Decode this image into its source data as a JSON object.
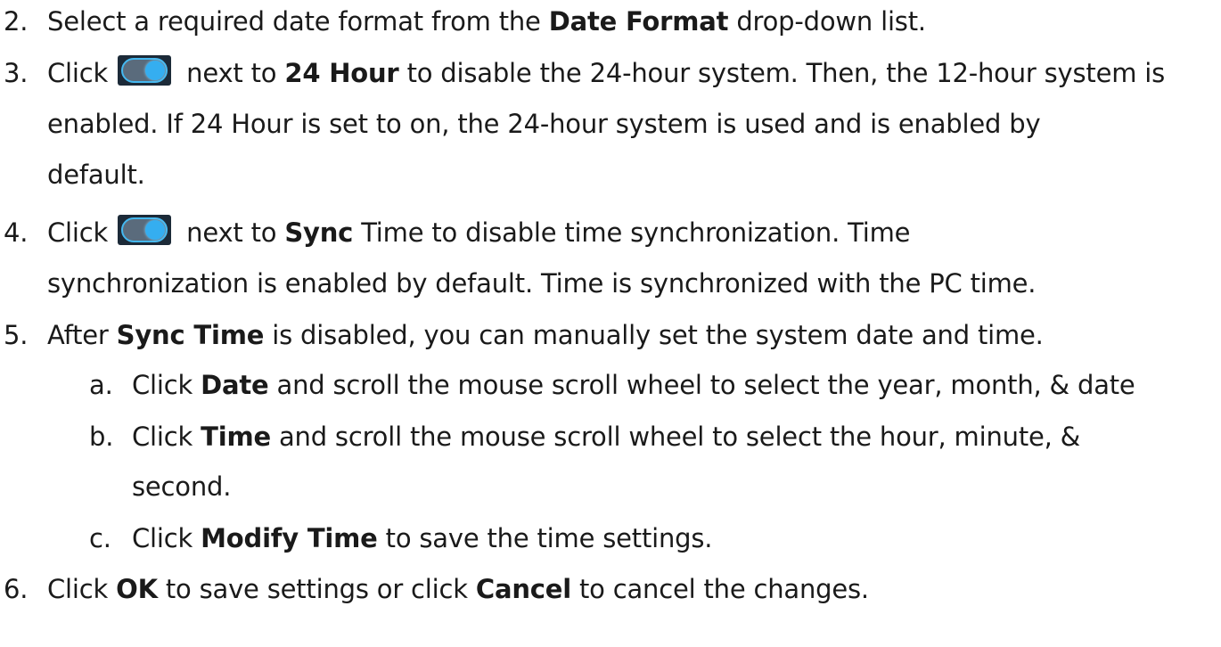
{
  "steps": [
    {
      "num": "2.",
      "parts": [
        "Select a required date format from the ",
        "Date Format",
        " drop-down list."
      ]
    },
    {
      "num": "3.",
      "parts": [
        "Click ",
        " next to ",
        "24 Hour",
        " to disable the 24-hour system. Then, the 12-hour system is"
      ],
      "cont1": "enabled. If 24 Hour is set to on, the 24-hour system is used and is enabled by",
      "cont2": "default."
    },
    {
      "num": "4.",
      "parts": [
        "Click ",
        " next to ",
        "Sync",
        " Time to disable time synchronization. Time"
      ],
      "cont1": "synchronization is enabled by default. Time is synchronized with the PC time."
    },
    {
      "num": "5.",
      "parts": [
        "After ",
        "Sync Time",
        " is disabled, you can manually set the system date and time."
      ],
      "substeps": [
        {
          "num": "a.",
          "parts": [
            "Click ",
            "Date",
            " and scroll the mouse scroll wheel to select the year, month, & date"
          ]
        },
        {
          "num": "b.",
          "parts": [
            "Click ",
            "Time",
            " and scroll the mouse scroll wheel to select the hour, minute, &"
          ],
          "cont1": "second."
        },
        {
          "num": "c.",
          "parts": [
            "Click ",
            "Modify Time",
            " to save the time settings."
          ]
        }
      ]
    },
    {
      "num": "6.",
      "parts": [
        "Click ",
        "OK",
        " to save settings or click ",
        "Cancel",
        " to cancel the changes."
      ]
    }
  ],
  "toggle_icon": "toggle-switch-on-icon",
  "colors": {
    "toggle_knob": "#35aef0",
    "toggle_border": "#44b8f0",
    "toggle_bg": "#1c2a38"
  }
}
